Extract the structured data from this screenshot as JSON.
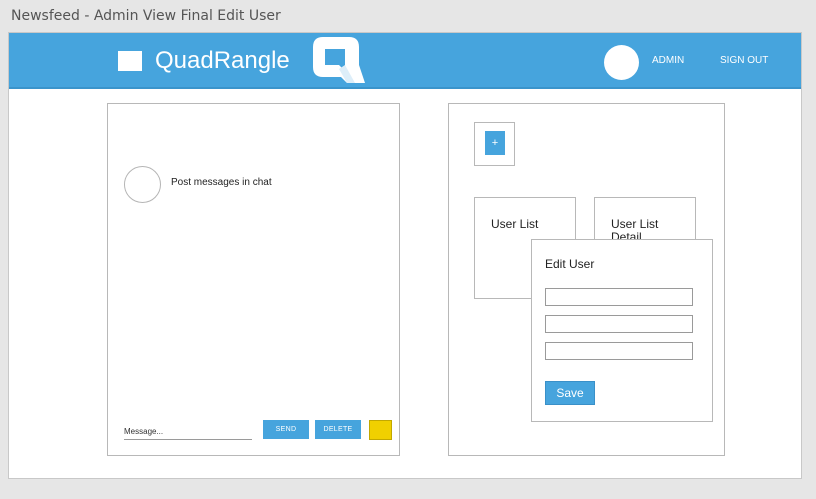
{
  "window": {
    "title": "Newsfeed - Admin View Final Edit User"
  },
  "header": {
    "brand": "QuadRangle",
    "logo_icon": "q-logo-icon",
    "nav": {
      "admin": "ADMIN",
      "sign_out": "SIGN OUT"
    },
    "accent_color": "#46a4dd"
  },
  "chat": {
    "post_text": "Post messages in chat",
    "message_placeholder": "Message...",
    "send_label": "SEND",
    "delete_label": "DELETE",
    "swatch_color": "#f0d000"
  },
  "admin_panel": {
    "add_label": "+",
    "cards": [
      {
        "label": "User List"
      },
      {
        "label": "User List Detail"
      }
    ]
  },
  "edit_user": {
    "title": "Edit User",
    "fields": [
      "",
      "",
      ""
    ],
    "save_label": "Save"
  }
}
